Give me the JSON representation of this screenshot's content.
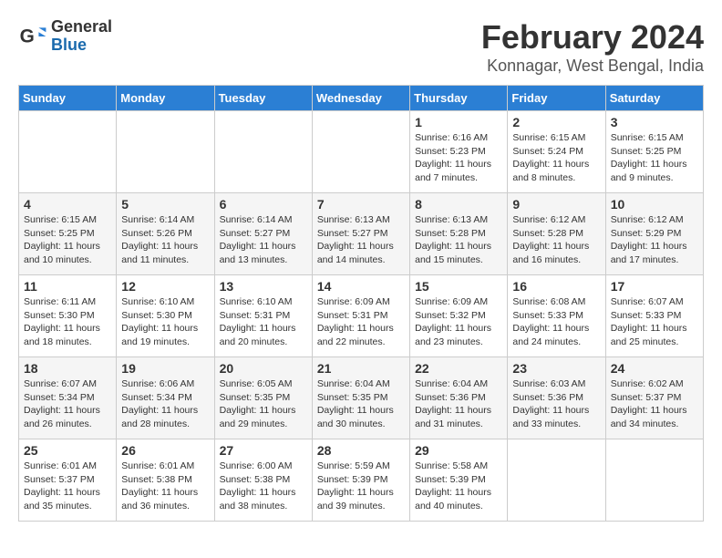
{
  "header": {
    "logo_line1": "General",
    "logo_line2": "Blue",
    "month": "February 2024",
    "location": "Konnagar, West Bengal, India"
  },
  "weekdays": [
    "Sunday",
    "Monday",
    "Tuesday",
    "Wednesday",
    "Thursday",
    "Friday",
    "Saturday"
  ],
  "weeks": [
    [
      {
        "day": "",
        "info": ""
      },
      {
        "day": "",
        "info": ""
      },
      {
        "day": "",
        "info": ""
      },
      {
        "day": "",
        "info": ""
      },
      {
        "day": "1",
        "info": "Sunrise: 6:16 AM\nSunset: 5:23 PM\nDaylight: 11 hours\nand 7 minutes."
      },
      {
        "day": "2",
        "info": "Sunrise: 6:15 AM\nSunset: 5:24 PM\nDaylight: 11 hours\nand 8 minutes."
      },
      {
        "day": "3",
        "info": "Sunrise: 6:15 AM\nSunset: 5:25 PM\nDaylight: 11 hours\nand 9 minutes."
      }
    ],
    [
      {
        "day": "4",
        "info": "Sunrise: 6:15 AM\nSunset: 5:25 PM\nDaylight: 11 hours\nand 10 minutes."
      },
      {
        "day": "5",
        "info": "Sunrise: 6:14 AM\nSunset: 5:26 PM\nDaylight: 11 hours\nand 11 minutes."
      },
      {
        "day": "6",
        "info": "Sunrise: 6:14 AM\nSunset: 5:27 PM\nDaylight: 11 hours\nand 13 minutes."
      },
      {
        "day": "7",
        "info": "Sunrise: 6:13 AM\nSunset: 5:27 PM\nDaylight: 11 hours\nand 14 minutes."
      },
      {
        "day": "8",
        "info": "Sunrise: 6:13 AM\nSunset: 5:28 PM\nDaylight: 11 hours\nand 15 minutes."
      },
      {
        "day": "9",
        "info": "Sunrise: 6:12 AM\nSunset: 5:28 PM\nDaylight: 11 hours\nand 16 minutes."
      },
      {
        "day": "10",
        "info": "Sunrise: 6:12 AM\nSunset: 5:29 PM\nDaylight: 11 hours\nand 17 minutes."
      }
    ],
    [
      {
        "day": "11",
        "info": "Sunrise: 6:11 AM\nSunset: 5:30 PM\nDaylight: 11 hours\nand 18 minutes."
      },
      {
        "day": "12",
        "info": "Sunrise: 6:10 AM\nSunset: 5:30 PM\nDaylight: 11 hours\nand 19 minutes."
      },
      {
        "day": "13",
        "info": "Sunrise: 6:10 AM\nSunset: 5:31 PM\nDaylight: 11 hours\nand 20 minutes."
      },
      {
        "day": "14",
        "info": "Sunrise: 6:09 AM\nSunset: 5:31 PM\nDaylight: 11 hours\nand 22 minutes."
      },
      {
        "day": "15",
        "info": "Sunrise: 6:09 AM\nSunset: 5:32 PM\nDaylight: 11 hours\nand 23 minutes."
      },
      {
        "day": "16",
        "info": "Sunrise: 6:08 AM\nSunset: 5:33 PM\nDaylight: 11 hours\nand 24 minutes."
      },
      {
        "day": "17",
        "info": "Sunrise: 6:07 AM\nSunset: 5:33 PM\nDaylight: 11 hours\nand 25 minutes."
      }
    ],
    [
      {
        "day": "18",
        "info": "Sunrise: 6:07 AM\nSunset: 5:34 PM\nDaylight: 11 hours\nand 26 minutes."
      },
      {
        "day": "19",
        "info": "Sunrise: 6:06 AM\nSunset: 5:34 PM\nDaylight: 11 hours\nand 28 minutes."
      },
      {
        "day": "20",
        "info": "Sunrise: 6:05 AM\nSunset: 5:35 PM\nDaylight: 11 hours\nand 29 minutes."
      },
      {
        "day": "21",
        "info": "Sunrise: 6:04 AM\nSunset: 5:35 PM\nDaylight: 11 hours\nand 30 minutes."
      },
      {
        "day": "22",
        "info": "Sunrise: 6:04 AM\nSunset: 5:36 PM\nDaylight: 11 hours\nand 31 minutes."
      },
      {
        "day": "23",
        "info": "Sunrise: 6:03 AM\nSunset: 5:36 PM\nDaylight: 11 hours\nand 33 minutes."
      },
      {
        "day": "24",
        "info": "Sunrise: 6:02 AM\nSunset: 5:37 PM\nDaylight: 11 hours\nand 34 minutes."
      }
    ],
    [
      {
        "day": "25",
        "info": "Sunrise: 6:01 AM\nSunset: 5:37 PM\nDaylight: 11 hours\nand 35 minutes."
      },
      {
        "day": "26",
        "info": "Sunrise: 6:01 AM\nSunset: 5:38 PM\nDaylight: 11 hours\nand 36 minutes."
      },
      {
        "day": "27",
        "info": "Sunrise: 6:00 AM\nSunset: 5:38 PM\nDaylight: 11 hours\nand 38 minutes."
      },
      {
        "day": "28",
        "info": "Sunrise: 5:59 AM\nSunset: 5:39 PM\nDaylight: 11 hours\nand 39 minutes."
      },
      {
        "day": "29",
        "info": "Sunrise: 5:58 AM\nSunset: 5:39 PM\nDaylight: 11 hours\nand 40 minutes."
      },
      {
        "day": "",
        "info": ""
      },
      {
        "day": "",
        "info": ""
      }
    ]
  ]
}
